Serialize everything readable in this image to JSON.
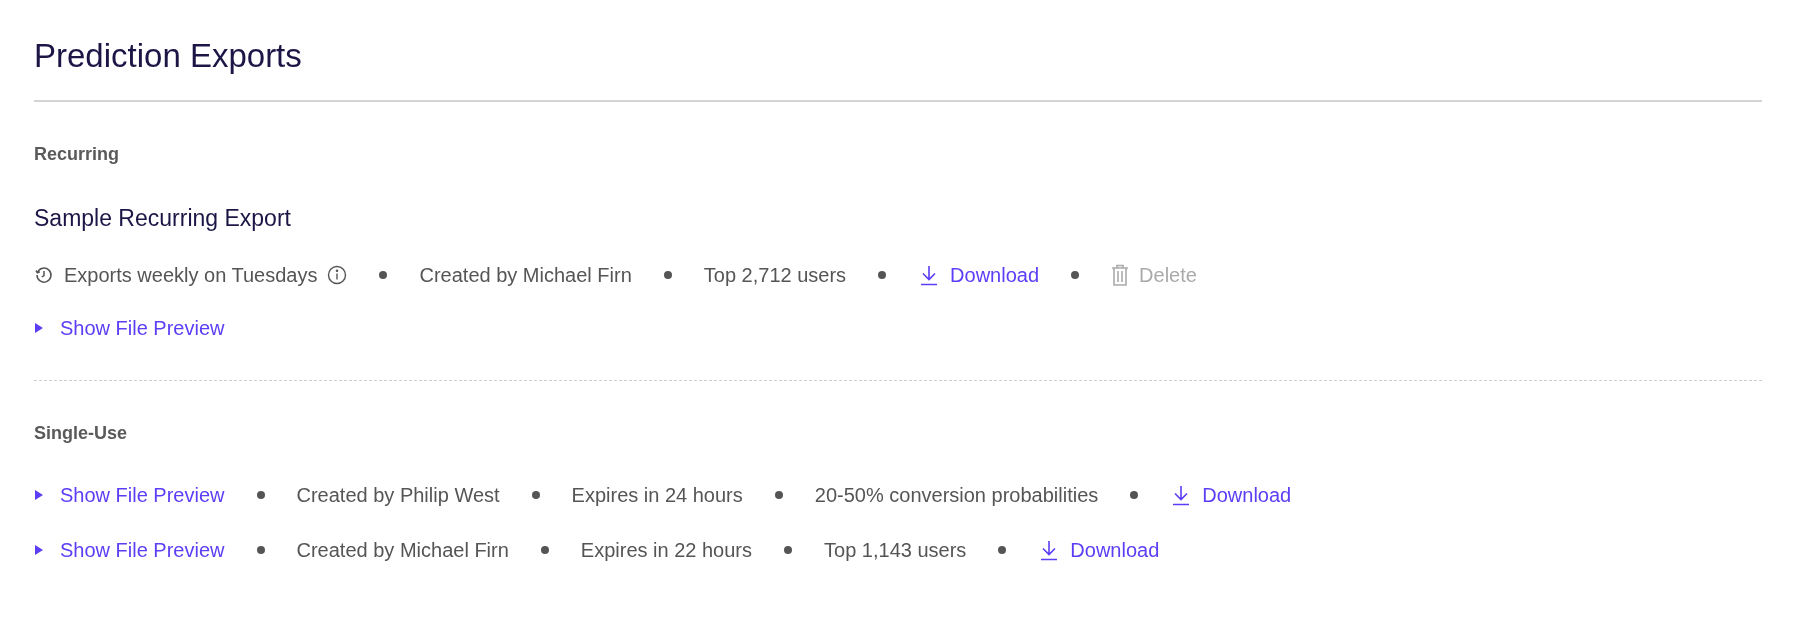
{
  "title": "Prediction Exports",
  "recurring": {
    "heading": "Recurring",
    "exports": [
      {
        "name": "Sample Recurring Export",
        "meta": [
          {
            "kind": "schedule",
            "text": "Exports weekly on Tuesdays"
          },
          {
            "kind": "text",
            "text": "Created by Michael Firn"
          },
          {
            "kind": "text",
            "text": "Top 2,712 users"
          },
          {
            "kind": "download",
            "text": "Download"
          },
          {
            "kind": "delete",
            "text": "Delete",
            "disabled": true
          }
        ],
        "preview": {
          "label": "Show File Preview",
          "expanded": false
        }
      }
    ]
  },
  "single_use": {
    "heading": "Single-Use",
    "exports": [
      {
        "preview": {
          "label": "Show File Preview",
          "expanded": false
        },
        "meta": [
          {
            "kind": "text",
            "text": "Created by Philip West"
          },
          {
            "kind": "text",
            "text": "Expires in 24 hours"
          },
          {
            "kind": "text",
            "text": "20-50% conversion probabilities"
          },
          {
            "kind": "download",
            "text": "Download"
          }
        ]
      },
      {
        "preview": {
          "label": "Show File Preview",
          "expanded": false
        },
        "meta": [
          {
            "kind": "text",
            "text": "Created by Michael Firn"
          },
          {
            "kind": "text",
            "text": "Expires in 22 hours"
          },
          {
            "kind": "text",
            "text": "Top 1,143 users"
          },
          {
            "kind": "download",
            "text": "Download"
          }
        ]
      }
    ]
  }
}
